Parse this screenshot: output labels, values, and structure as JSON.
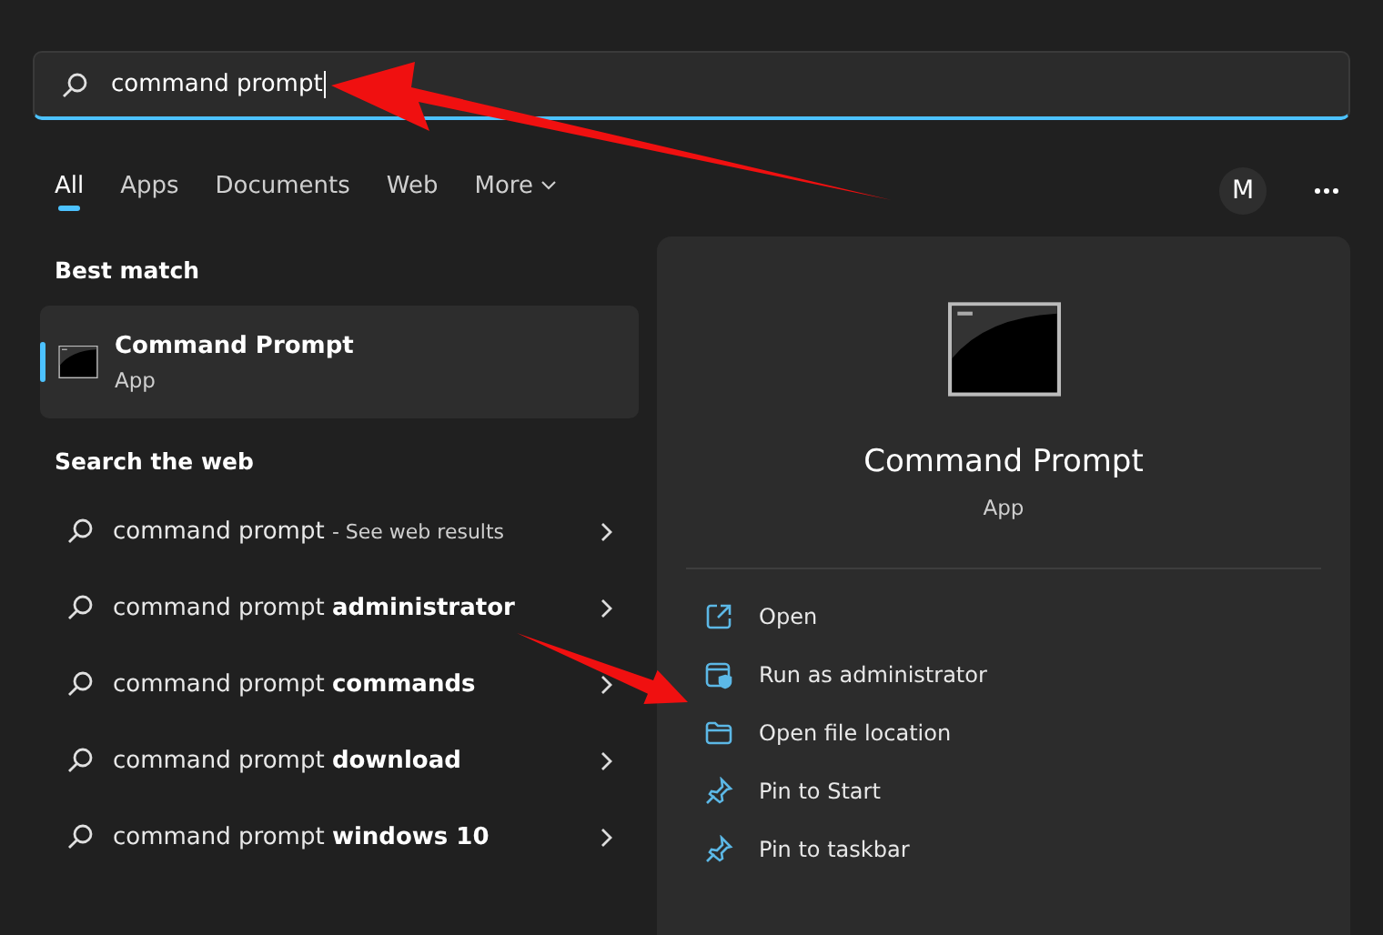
{
  "search": {
    "value": "command prompt"
  },
  "tabs": [
    {
      "label": "All",
      "selected": true
    },
    {
      "label": "Apps",
      "selected": false
    },
    {
      "label": "Documents",
      "selected": false
    },
    {
      "label": "Web",
      "selected": false
    },
    {
      "label": "More",
      "selected": false,
      "kind": "dropdown"
    }
  ],
  "account": {
    "initial": "M"
  },
  "best_match": {
    "heading": "Best match",
    "title": "Command Prompt",
    "subtitle": "App",
    "selected": true
  },
  "web": {
    "heading": "Search the web",
    "results": [
      {
        "text": "command prompt",
        "note": "- See web results"
      },
      {
        "text": "command prompt **administrator**"
      },
      {
        "text": "command prompt **commands**"
      },
      {
        "text": "command prompt **download**"
      },
      {
        "text": "command prompt **windows 10**"
      }
    ]
  },
  "details": {
    "title": "Command Prompt",
    "subtitle": "App",
    "actions": [
      {
        "label": "Open",
        "kind": "open"
      },
      {
        "label": "Run as administrator",
        "kind": "admin"
      },
      {
        "label": "Open file location",
        "kind": "folder"
      },
      {
        "label": "Pin to Start",
        "kind": "pin"
      },
      {
        "label": "Pin to taskbar",
        "kind": "pin"
      }
    ]
  }
}
